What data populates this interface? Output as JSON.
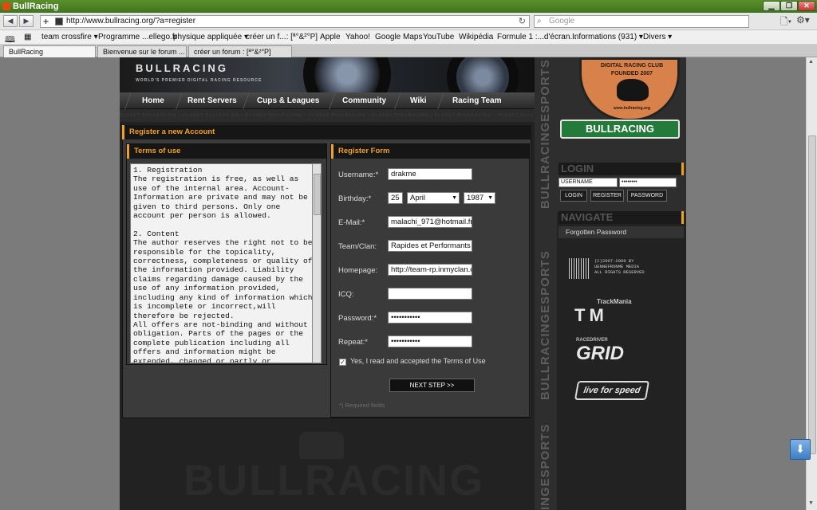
{
  "browser": {
    "title": "BullRacing",
    "url": "http://www.bullracing.org/?a=register",
    "search_placeholder": "Google",
    "bookmarks": [
      "team crossfire ▾",
      "Programme ...ellego.fr",
      "physique appliquée ▾",
      "créer un f...: [ª°&²°P]",
      "Apple",
      "Yahoo!",
      "Google Maps",
      "YouTube",
      "Wikipédia",
      "Formule 1 :...d'écran...",
      "Informations (931) ▾",
      "Divers ▾"
    ],
    "tabs": [
      "BullRacing",
      "Bienvenue sur le forum ...",
      "créer un forum : [ª°&²°P]"
    ]
  },
  "site": {
    "logo": "BULLRACING",
    "logo_tagline": "WORLD'S PREMIER DIGITAL RACING RESOURCE",
    "nav": [
      "Home",
      "Rent Servers",
      "Cups & Leagues",
      "Community",
      "Wiki",
      "Racing Team"
    ],
    "stripe_text": "PLANET BULLRACING • PLANET BULLRACING • PLANET BULLRACING • PLANET BULLRACING • PLANET BULLRACING • PLANET BULLRACING • PLANET BULLRACING • PLANET BULLRACING"
  },
  "register": {
    "panel_title": "Register a new Account",
    "terms_title": "Terms of use",
    "terms_text": "1. Registration\nThe registration is free, as well as\nuse of the internal area. Account-\nInformation are private and may not be\ngiven to third persons. Only one\naccount per person is allowed.\n\n2. Content\nThe author reserves the right not to be\nresponsible for the topicality,\ncorrectness, completeness or quality of\nthe information provided. Liability\nclaims regarding damage caused by the\nuse of any information provided,\nincluding any kind of information which\nis incomplete or incorrect,will\ntherefore be rejected.\nAll offers are not-binding and without\nobligation. Parts of the pages or the\ncomplete publication including all\noffers and information might be\nextended, changed or partly or",
    "form_title": "Register Form",
    "labels": {
      "username": "Username:*",
      "birthday": "Birthday:*",
      "email": "E-Mail:*",
      "team": "Team/Clan:",
      "homepage": "Homepage:",
      "icq": "ICQ:",
      "password": "Password:*",
      "repeat": "Repeat:*"
    },
    "values": {
      "username": "drakme",
      "day": "25",
      "month": "April",
      "year": "1987",
      "email": "malachi_971@hotmail.fr",
      "team": "Rapides et Performants",
      "homepage": "http://team-rp.inmyclan.c",
      "icq": "",
      "password": "•••••••••••",
      "repeat": "•••••••••••"
    },
    "accept_label": "Yes, I read and accepted the Terms of Use",
    "accept_checked": "✓",
    "next_button": "NEXT STEP >>",
    "required_note": "*) Required fields"
  },
  "vertical_text": [
    "BULLRACINGESPORTS",
    "BULLRACINGESPORTS",
    "INGESPORTS"
  ],
  "sidebar": {
    "badge_top": "DIGITAL RACING CLUB",
    "badge_mid": "FOUNDED 2007",
    "badge_url": "www.bullracing.org",
    "ribbon": "BULLRACING",
    "login_title": "LOGIN",
    "username_placeholder": "USERNAME",
    "password_value": "••••••••",
    "buttons": [
      "LOGIN",
      "REGISTER",
      "PASSWORD"
    ],
    "navigate_title": "NAVIGATE",
    "forgotten_password": "Forgotten Password",
    "copyright": "(C)2007-2009 BY\nUENNEFRONME MEDIA\nALL RIGHTS RESERVED",
    "partners": [
      "TrackMania",
      "TM",
      "RACEDRIVER",
      "GRID",
      "live for speed"
    ]
  },
  "watermark": "BULLRACING"
}
